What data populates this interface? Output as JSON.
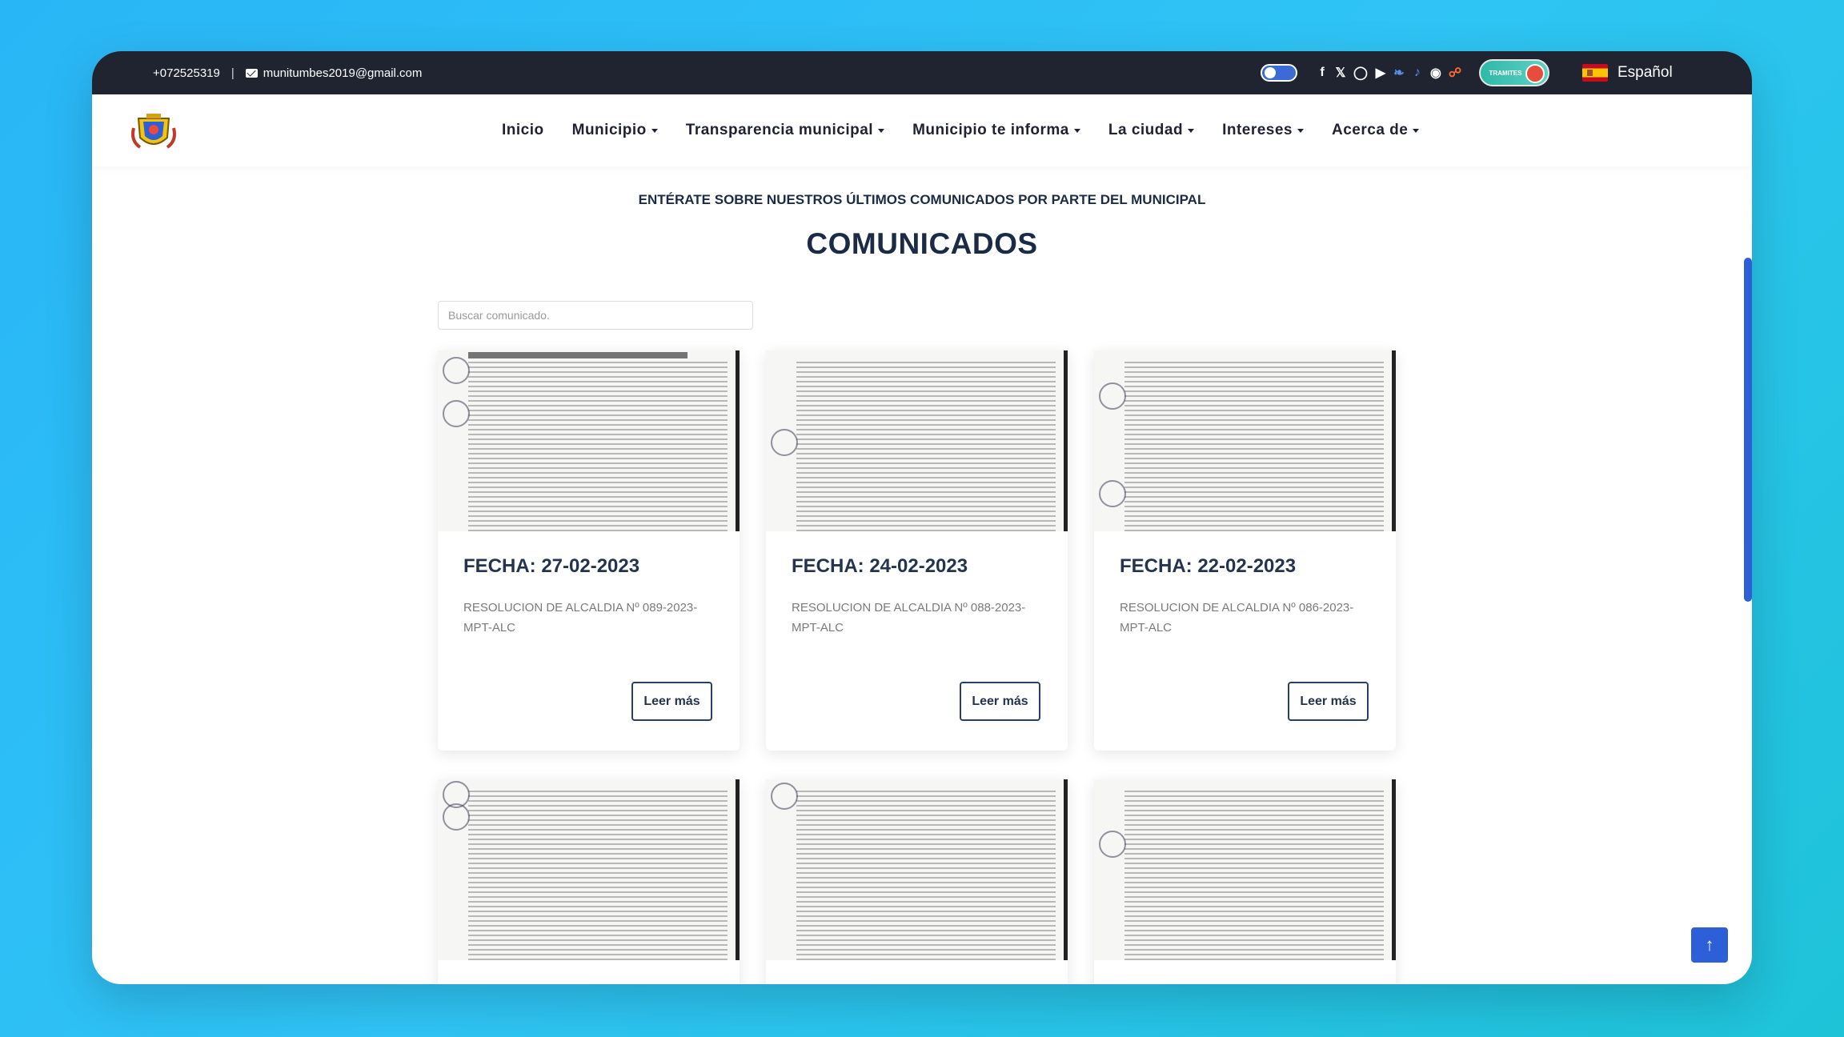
{
  "topbar": {
    "phone": "+072525319",
    "separator": "|",
    "email": "munitumbes2019@gmail.com",
    "social_icons": [
      "facebook-icon",
      "twitter-icon",
      "instagram-icon",
      "youtube-icon",
      "bluesky-icon",
      "tiktok-icon",
      "web-icon",
      "link-icon"
    ],
    "tramite_label": "TRAMITES",
    "language": "Español"
  },
  "nav": {
    "items": [
      {
        "label": "Inicio",
        "dropdown": false
      },
      {
        "label": "Municipio",
        "dropdown": true
      },
      {
        "label": "Transparencia municipal",
        "dropdown": true
      },
      {
        "label": "Municipio te informa",
        "dropdown": true
      },
      {
        "label": "La ciudad",
        "dropdown": true
      },
      {
        "label": "Intereses",
        "dropdown": true
      },
      {
        "label": "Acerca de",
        "dropdown": true
      }
    ]
  },
  "page": {
    "subtitle": "ENTÉRATE SOBRE NUESTROS ÚLTIMOS COMUNICADOS POR PARTE DEL MUNICIPAL",
    "title": "COMUNICADOS",
    "search_placeholder": "Buscar comunicado."
  },
  "cards": [
    {
      "date": "FECHA: 27-02-2023",
      "description": "RESOLUCION DE ALCALDIA Nº 089-2023-MPT-ALC",
      "button": "Leer más"
    },
    {
      "date": "FECHA: 24-02-2023",
      "description": "RESOLUCION DE ALCALDIA Nº 088-2023-MPT-ALC",
      "button": "Leer más"
    },
    {
      "date": "FECHA: 22-02-2023",
      "description": "RESOLUCION DE ALCALDIA Nº 086-2023-MPT-ALC",
      "button": "Leer más"
    }
  ],
  "colors": {
    "topbar_bg": "#1f2430",
    "heading": "#1c2b45",
    "accent": "#2c5fd8",
    "background_gradient_start": "#29b6f6",
    "background_gradient_end": "#1ec3d8"
  }
}
